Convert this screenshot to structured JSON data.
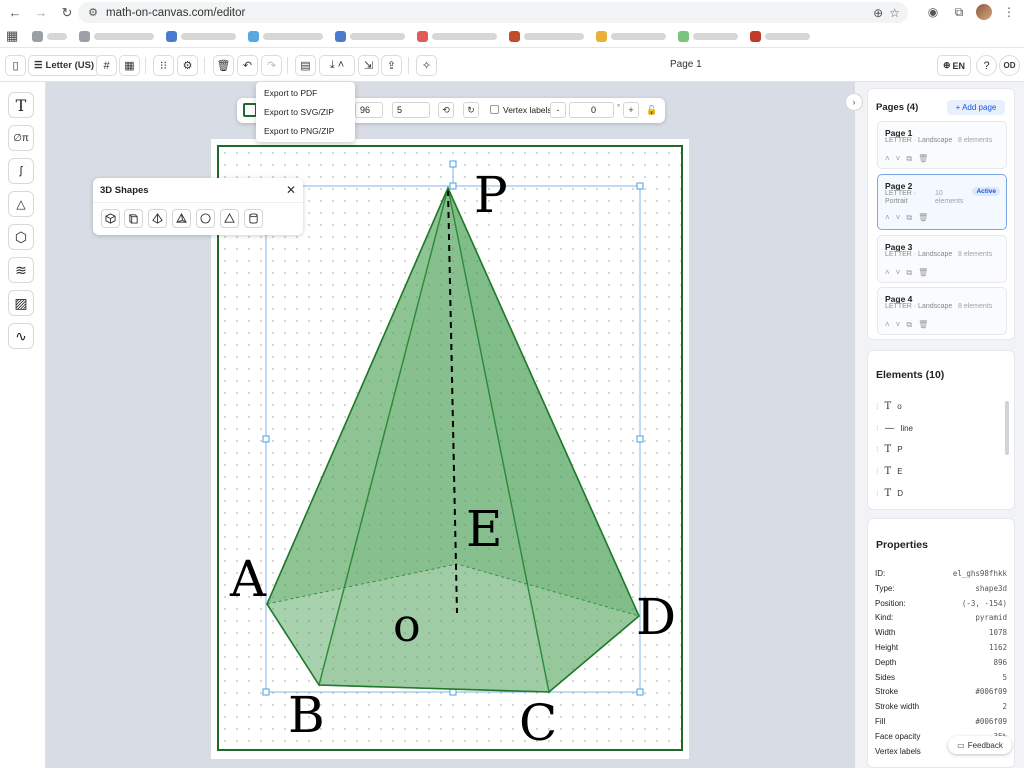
{
  "browser": {
    "url": "math-on-canvas.com/editor",
    "bookmarks": [
      {
        "color": "#9aa0a6",
        "width": 20
      },
      {
        "color": "#9aa0a6",
        "width": 60
      },
      {
        "color": "#4a7bd0",
        "width": 55
      },
      {
        "color": "#59a8e0",
        "width": 60
      },
      {
        "color": "#4a7bd0",
        "width": 55
      },
      {
        "color": "#e05a5a",
        "width": 65
      },
      {
        "color": "#c44a2a",
        "width": 60
      },
      {
        "color": "#e8b13a",
        "width": 55
      },
      {
        "color": "#7bc47f",
        "width": 45
      },
      {
        "color": "#c0392b",
        "width": 45
      }
    ]
  },
  "toolbar": {
    "paper_size": "Letter (US)",
    "page_title": "Page 1",
    "language": "EN",
    "user_initials": "OD"
  },
  "export_menu": {
    "items": [
      "Export to PDF",
      "Export to SVG/ZIP",
      "Export to PNG/ZIP"
    ]
  },
  "shape_bar": {
    "value1": "96",
    "value2": "5",
    "vertex_labels_label": "Vertex labels",
    "rotation": "0",
    "degree_sign": "°"
  },
  "shapes_panel": {
    "title": "3D Shapes"
  },
  "canvas": {
    "labels": {
      "P": "P",
      "A": "A",
      "B": "B",
      "C": "C",
      "D": "D",
      "E": "E",
      "O": "o"
    },
    "stroke": "#006f09",
    "fill": "#006f09"
  },
  "pages_panel": {
    "title": "Pages (4)",
    "add_label": "+ Add page",
    "pages": [
      {
        "title": "Page 1",
        "meta": "LETTER · Landscape",
        "count": "8 elements",
        "active": false
      },
      {
        "title": "Page 2",
        "meta": "LETTER · Portrait",
        "count": "10 elements",
        "active": true,
        "badge": "Active"
      },
      {
        "title": "Page 3",
        "meta": "LETTER · Landscape",
        "count": "8 elements",
        "active": false
      },
      {
        "title": "Page 4",
        "meta": "LETTER · Landscape",
        "count": "8 elements",
        "active": false
      }
    ]
  },
  "elements_panel": {
    "title": "Elements (10)",
    "items": [
      {
        "icon": "T",
        "label": "o"
      },
      {
        "icon": "—",
        "label": "line"
      },
      {
        "icon": "T",
        "label": "P"
      },
      {
        "icon": "T",
        "label": "E"
      },
      {
        "icon": "T",
        "label": "D"
      }
    ]
  },
  "properties_panel": {
    "title": "Properties",
    "rows": [
      {
        "key": "ID:",
        "value": "el_ghs98fhkk"
      },
      {
        "key": "Type:",
        "value": "shape3d"
      },
      {
        "key": "Position:",
        "value": "(-3, -154)"
      },
      {
        "key": "Kind:",
        "value": "pyramid"
      },
      {
        "key": "Width",
        "value": "1078"
      },
      {
        "key": "Height",
        "value": "1162"
      },
      {
        "key": "Depth",
        "value": "896"
      },
      {
        "key": "Sides",
        "value": "5"
      },
      {
        "key": "Stroke",
        "value": "#006f09"
      },
      {
        "key": "Stroke width",
        "value": "2"
      },
      {
        "key": "Fill",
        "value": "#006f09"
      },
      {
        "key": "Face opacity",
        "value": "35%"
      },
      {
        "key": "Vertex labels",
        "value": ""
      }
    ]
  },
  "feedback_label": "Feedback"
}
